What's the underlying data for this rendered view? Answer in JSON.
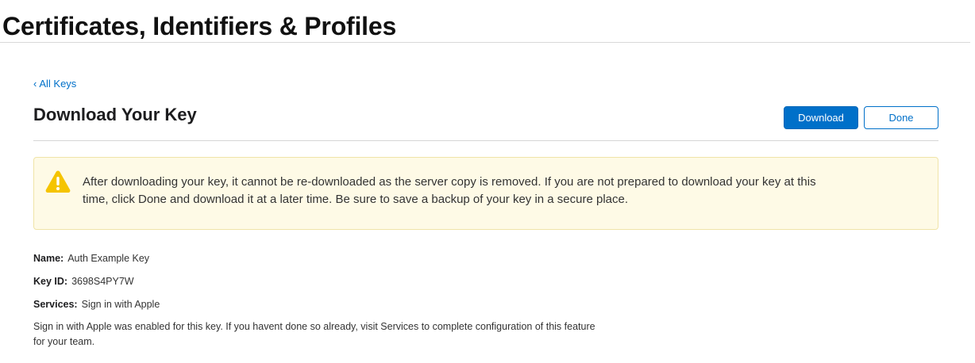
{
  "header": {
    "title": "Certificates, Identifiers & Profiles"
  },
  "nav": {
    "back_chevron": "‹",
    "back_label": "All Keys"
  },
  "page": {
    "title": "Download Your Key",
    "download_label": "Download",
    "done_label": "Done"
  },
  "warning": {
    "icon": "warning-triangle-icon",
    "text": "After downloading your key, it cannot be re-downloaded as the server copy is removed. If you are not prepared to download your key at this time, click Done and download it at a later time. Be sure to save a backup of your key in a secure place."
  },
  "key_details": {
    "name_label": "Name:",
    "name_value": "Auth Example Key",
    "key_id_label": "Key ID:",
    "key_id_value": "3698S4PY7W",
    "services_label": "Services:",
    "services_value": "Sign in with Apple"
  },
  "note": {
    "text": "Sign in with Apple was enabled for this key. If you havent done so already, visit Services to complete configuration of this feature for your team."
  },
  "colors": {
    "accent": "#0070c9",
    "warning_bg": "#fefae6",
    "warning_icon": "#f5c400"
  }
}
